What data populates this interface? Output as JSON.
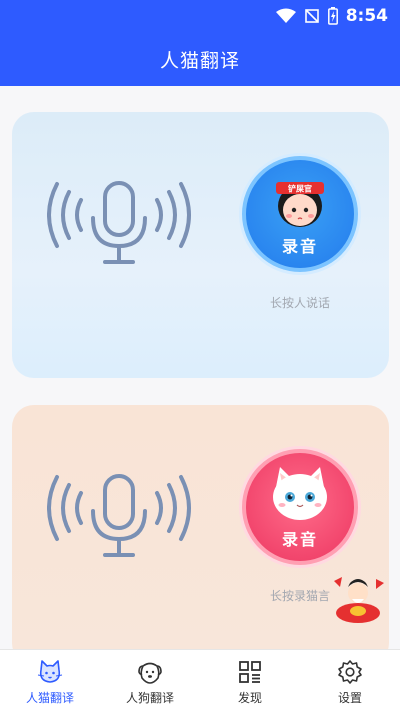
{
  "status_bar": {
    "time": "8:54"
  },
  "header": {
    "title": "人猫翻译"
  },
  "human_card": {
    "record_label": "录音",
    "badge_text": "铲屎官",
    "hint": "长按人说话",
    "accent": "#2a86ef"
  },
  "cat_card": {
    "record_label": "录音",
    "hint": "长按录猫言",
    "accent": "#f2466d"
  },
  "tabs": [
    {
      "label": "人猫翻译",
      "icon": "cat-icon",
      "active": true
    },
    {
      "label": "人狗翻译",
      "icon": "dog-icon",
      "active": false
    },
    {
      "label": "发现",
      "icon": "grid-icon",
      "active": false
    },
    {
      "label": "设置",
      "icon": "gear-icon",
      "active": false
    }
  ],
  "colors": {
    "brand": "#2e5bff",
    "tab_active": "#2e5bff"
  }
}
